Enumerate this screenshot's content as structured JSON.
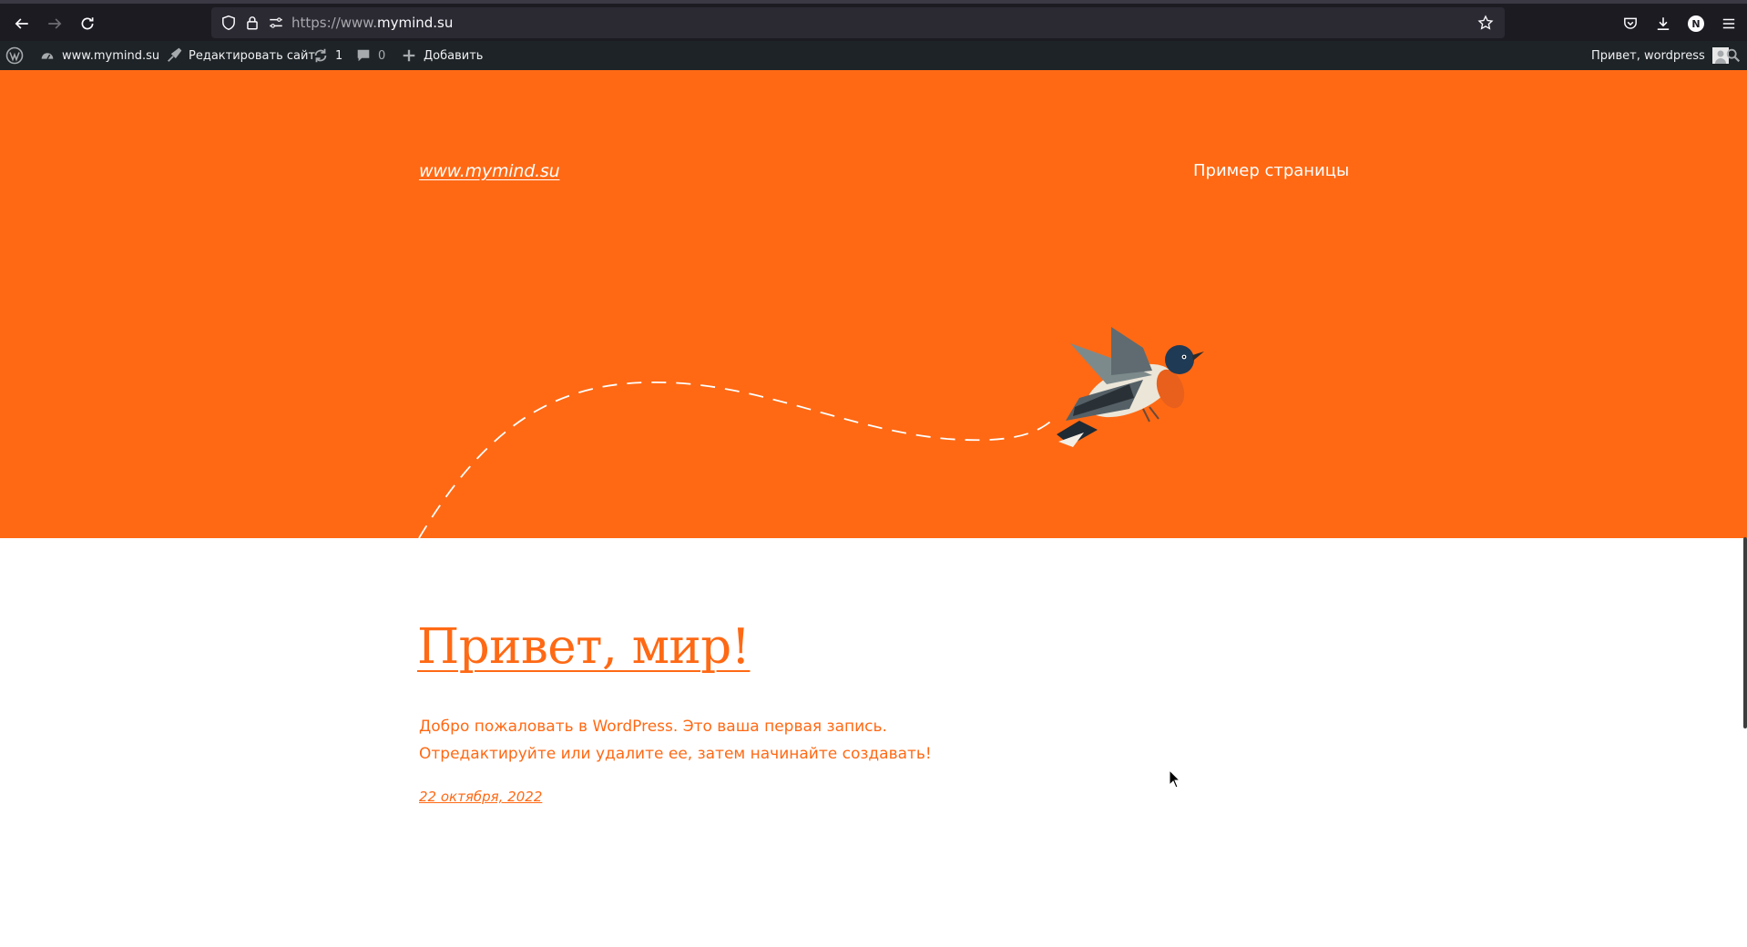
{
  "browser": {
    "url_prefix": "https://www.",
    "url_domain": "mymind.su",
    "profile_initial": "N"
  },
  "adminbar": {
    "site_name": "www.mymind.su",
    "edit_site": "Редактировать сайт",
    "updates_count": "1",
    "comments_count": "0",
    "add_new": "Добавить",
    "greeting": "Привет, wordpress"
  },
  "site": {
    "title": "www.mymind.su",
    "nav_item": "Пример страницы"
  },
  "post": {
    "title": "Привет, мир!",
    "excerpt": "Добро пожаловать в WordPress. Это ваша первая запись. Отредактируйте или удалите ее, затем начинайте создавать!",
    "date": "22 октября, 2022"
  },
  "colors": {
    "accent": "#ff6914",
    "browser_bg": "#1c1b22",
    "adminbar_bg": "#1d2327"
  }
}
